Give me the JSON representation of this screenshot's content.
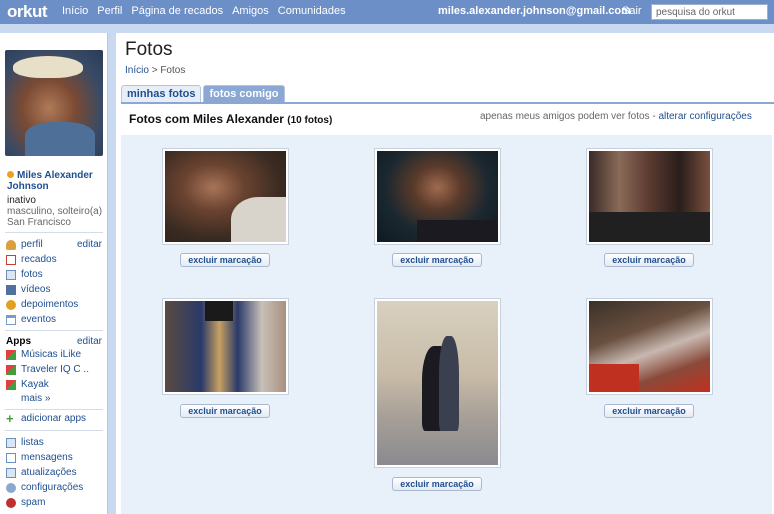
{
  "topbar": {
    "logo": "orkut",
    "nav": [
      "Início",
      "Perfil",
      "Página de recados",
      "Amigos",
      "Comunidades"
    ],
    "email": "miles.alexander.johnson@gmail.com",
    "logout": "Sair",
    "search_placeholder": "pesquisa do orkut"
  },
  "profile": {
    "name": "Miles Alexander Johnson",
    "status": "inativo",
    "info": "masculino, solteiro(a)",
    "city": "San Francisco"
  },
  "menu": [
    {
      "label": "perfil",
      "icon": "profile-icon",
      "edit": "editar",
      "color": "#d9a040"
    },
    {
      "label": "recados",
      "icon": "scrap-icon",
      "color": "#c84030"
    },
    {
      "label": "fotos",
      "icon": "photos-icon",
      "color": "#6a8fc0"
    },
    {
      "label": "vídeos",
      "icon": "videos-icon",
      "color": "#5070a0"
    },
    {
      "label": "depoimentos",
      "icon": "testimonials-icon",
      "color": "#e0a020"
    },
    {
      "label": "eventos",
      "icon": "events-icon",
      "color": "#7a9ac8"
    }
  ],
  "apps": {
    "title": "Apps",
    "edit": "editar",
    "items": [
      {
        "label": "Músicas iLike",
        "icon": "app-cube-icon"
      },
      {
        "label": "Traveler IQ C ..",
        "icon": "app-cube-icon"
      },
      {
        "label": "Kayak",
        "icon": "app-cube-icon"
      }
    ],
    "more": "mais »",
    "add": "adicionar apps"
  },
  "menu2": [
    {
      "label": "listas",
      "icon": "lists-icon",
      "color": "#6a8fc0"
    },
    {
      "label": "mensagens",
      "icon": "messages-icon",
      "color": "#6a8fc0"
    },
    {
      "label": "atualizações",
      "icon": "updates-icon",
      "color": "#6a8fc0"
    },
    {
      "label": "configurações",
      "icon": "settings-icon",
      "color": "#6a8fc0"
    },
    {
      "label": "spam",
      "icon": "spam-icon",
      "color": "#c03030"
    }
  ],
  "main": {
    "title": "Fotos",
    "breadcrumb_home": "Início",
    "breadcrumb_sep": ">",
    "breadcrumb_current": "Fotos",
    "tabs": [
      {
        "label": "minhas fotos",
        "active": false
      },
      {
        "label": "fotos comigo",
        "active": true
      }
    ],
    "heading": "Fotos com Miles Alexander",
    "count": "(10 fotos)",
    "privacy_text": "apenas meus amigos podem ver fotos -",
    "privacy_link": "alterar configurações",
    "remove_label": "excluir marcação"
  },
  "colors": {
    "topbar": "#6d8fc7",
    "link": "#1f4f8f",
    "page_bg": "#c9d9ef",
    "grid_bg": "#e8f0fa"
  }
}
